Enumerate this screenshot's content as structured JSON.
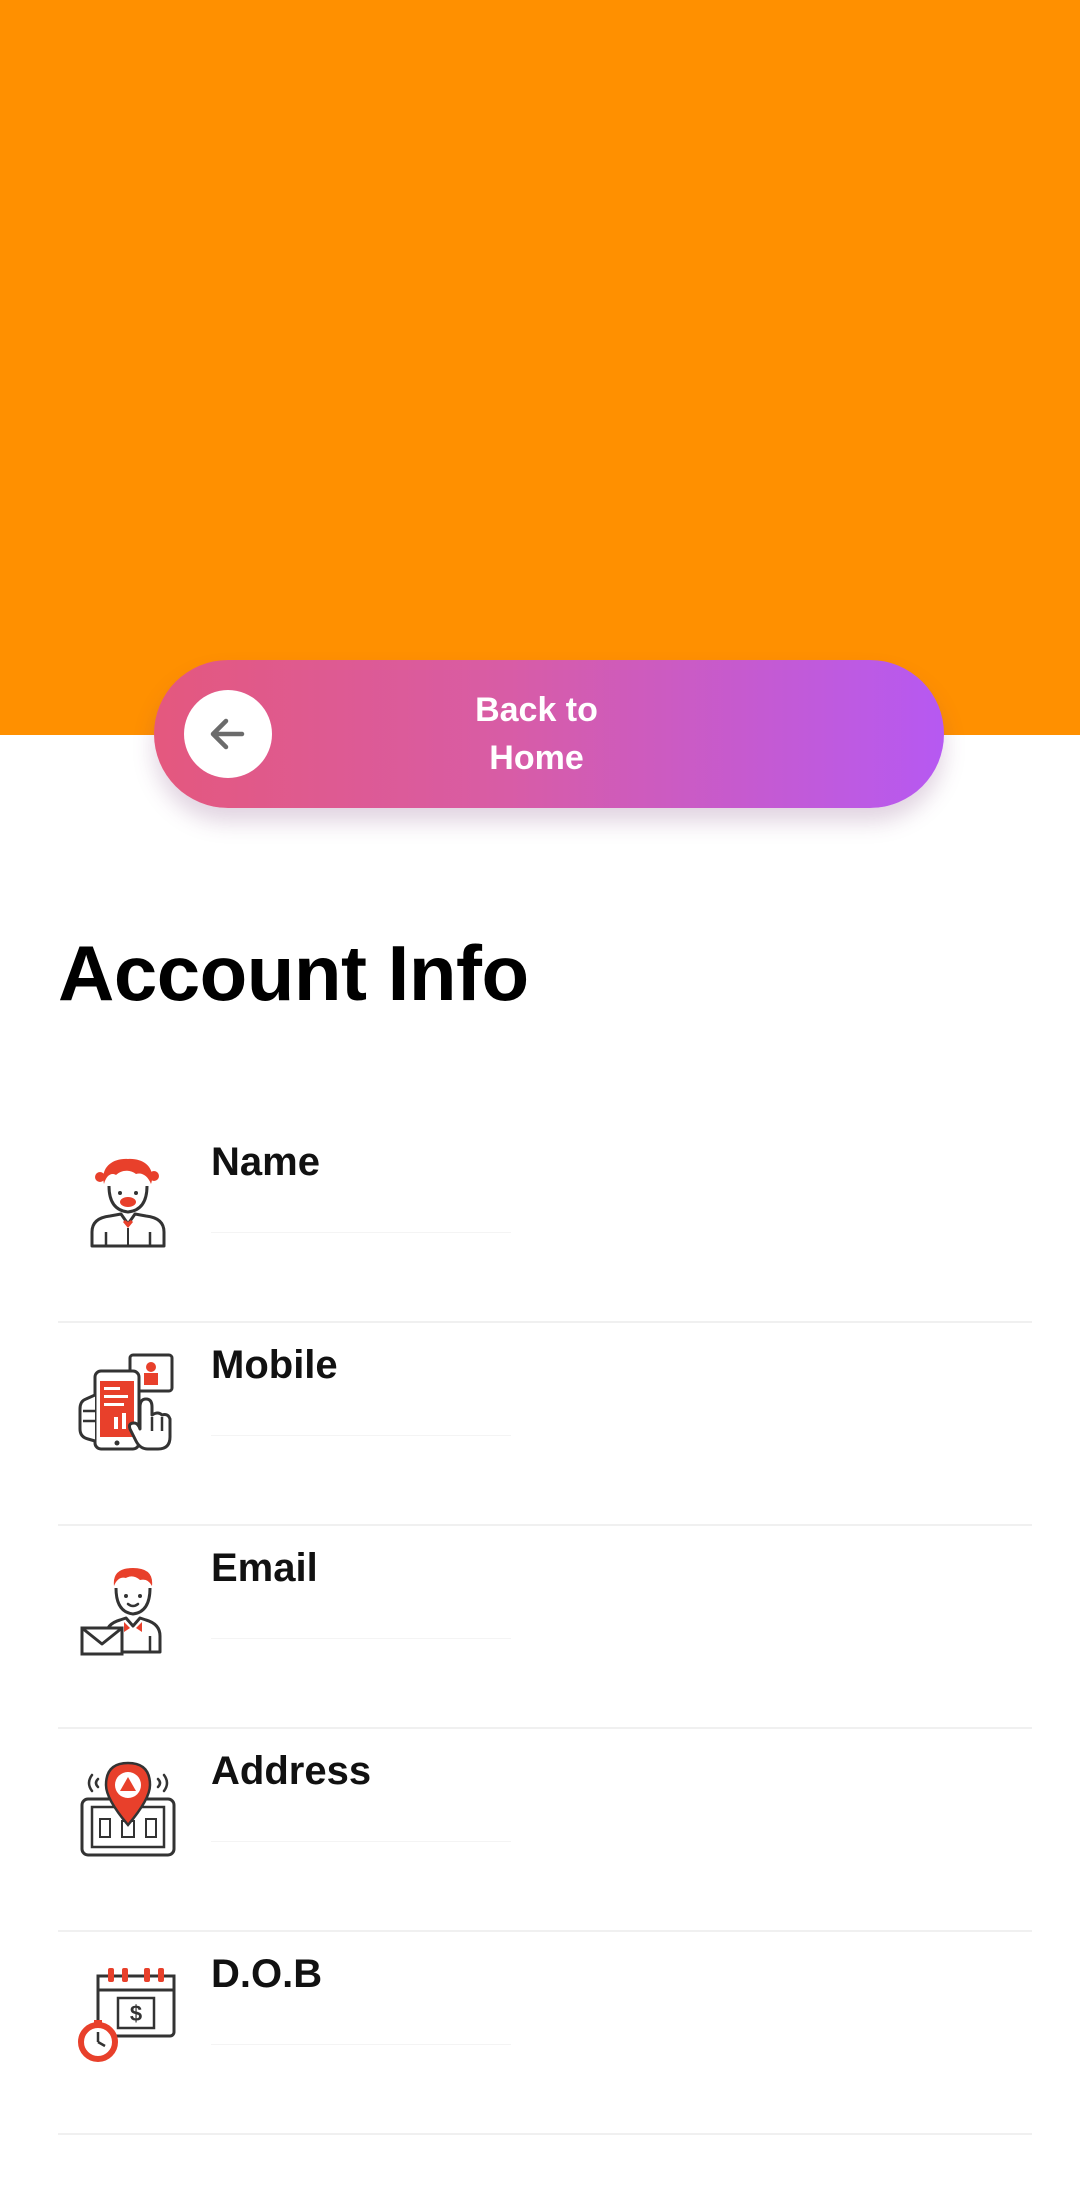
{
  "header": {
    "background_color": "#ff9000"
  },
  "back_button": {
    "label": "Back to Home",
    "icon": "arrow-left-icon",
    "gradient_start": "#e4587e",
    "gradient_end": "#b659f2"
  },
  "page": {
    "title": "Account Info"
  },
  "fields": [
    {
      "label": "Name",
      "value": "",
      "icon": "person-avatar-icon"
    },
    {
      "label": "Mobile",
      "value": "",
      "icon": "mobile-phone-icon"
    },
    {
      "label": "Email",
      "value": "",
      "icon": "person-email-icon"
    },
    {
      "label": "Address",
      "value": "",
      "icon": "location-pin-icon"
    },
    {
      "label": "D.O.B",
      "value": "",
      "icon": "calendar-clock-icon"
    }
  ],
  "colors": {
    "accent_red": "#e8402b",
    "icon_outline": "#333333"
  }
}
